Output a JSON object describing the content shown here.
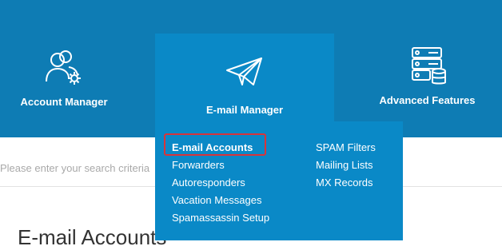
{
  "nav": {
    "account_manager": "Account Manager",
    "email_manager": "E-mail Manager",
    "advanced_features": "Advanced Features"
  },
  "dropdown": {
    "col1": [
      "E-mail Accounts",
      "Forwarders",
      "Autoresponders",
      "Vacation Messages",
      "Spamassassin Setup"
    ],
    "col2": [
      "SPAM Filters",
      "Mailing Lists",
      "MX Records"
    ]
  },
  "search": {
    "placeholder": "Please enter your search criteria"
  },
  "colors": {
    "nav_bg": "#0e7cb4",
    "active_bg": "#0a89c7",
    "highlight": "#d9343a"
  },
  "icons": [
    "users-gear-icon",
    "paper-plane-icon",
    "server-database-icon"
  ]
}
